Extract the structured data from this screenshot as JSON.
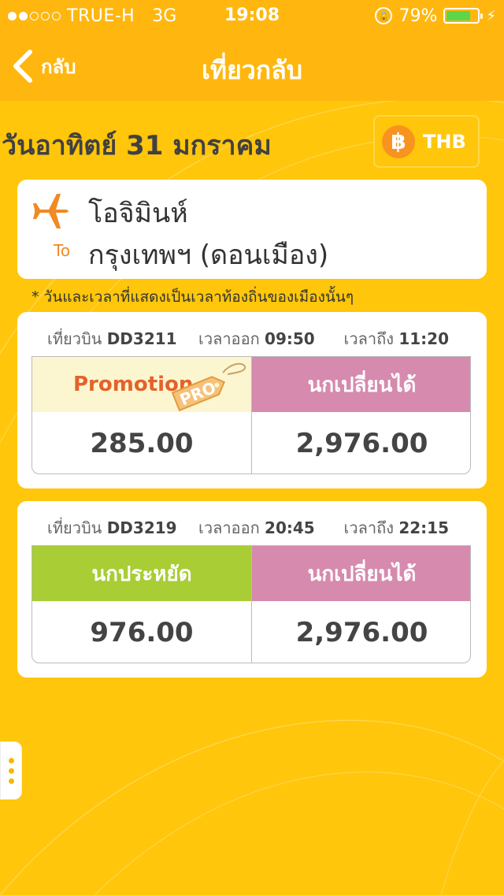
{
  "status_bar": {
    "signal_filled": 2,
    "signal_total": 5,
    "carrier": "TRUE-H",
    "network": "3G",
    "time": "19:08",
    "battery": "79%",
    "battery_level": 0.79
  },
  "nav": {
    "back_label": "กลับ",
    "title": "เที่ยวกลับ"
  },
  "date_title": "วันอาทิตย์ 31 มกราคม",
  "currency": {
    "symbol": "฿",
    "code": "THB"
  },
  "route": {
    "origin": "โอจิมินห์",
    "to_label": "To",
    "destination": "กรุงเทพฯ (ดอนเมือง)"
  },
  "note": "* วันและเวลาที่แสดงเป็นเวลาท้องถิ่นของเมืองนั้นๆ",
  "flights": [
    {
      "flight_label": "เที่ยวบิน",
      "flight_no": "DD3211",
      "depart_label": "เวลาออก",
      "depart_time": "09:50",
      "arrive_label": "เวลาถึง",
      "arrive_time": "11:20",
      "fares": [
        {
          "name": "Promotion",
          "price": "285.00",
          "tag": "PRO"
        },
        {
          "name": "นกเปลี่ยนได้",
          "price": "2,976.00"
        }
      ]
    },
    {
      "flight_label": "เที่ยวบิน",
      "flight_no": "DD3219",
      "depart_label": "เวลาออก",
      "depart_time": "20:45",
      "arrive_label": "เวลาถึง",
      "arrive_time": "22:15",
      "fares": [
        {
          "name": "นกประหยัด",
          "price": "976.00"
        },
        {
          "name": "นกเปลี่ยนได้",
          "price": "2,976.00"
        }
      ]
    }
  ],
  "colors": {
    "background": "#ffc60b",
    "navbar": "#ffb70f",
    "promo_bg": "#fbf6d0",
    "promo_text": "#e4622a",
    "flexi": "#d68aae",
    "saver": "#a8cd35",
    "accent_orange": "#f08a24"
  }
}
